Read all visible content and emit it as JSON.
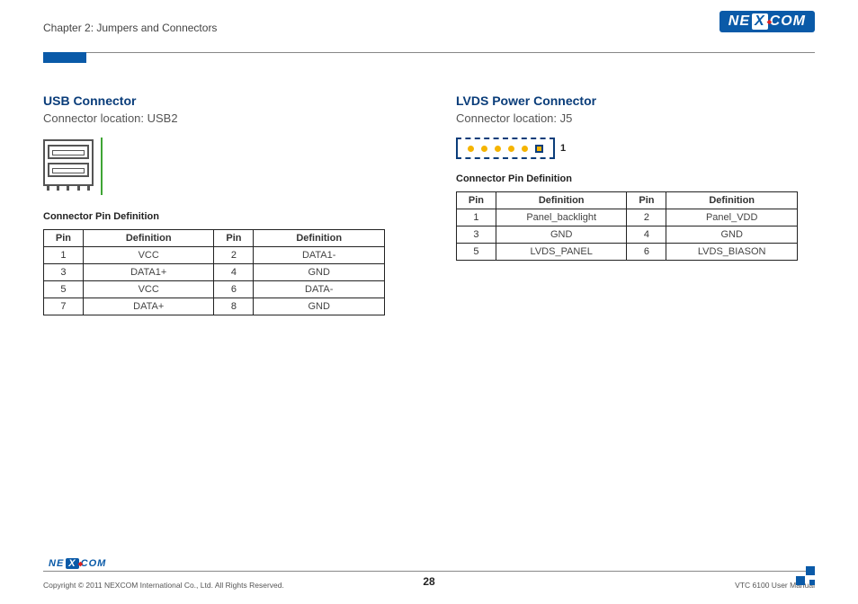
{
  "header": {
    "chapter": "Chapter 2: Jumpers and Connectors",
    "logo_text_left": "NE",
    "logo_text_mid": "X",
    "logo_text_right": "COM"
  },
  "left": {
    "title": "USB Connector",
    "subtitle": "Connector location: USB2",
    "table_title": "Connector Pin Definition",
    "headers": {
      "pin": "Pin",
      "def": "Definition"
    },
    "rows": [
      {
        "p1": "1",
        "d1": "VCC",
        "p2": "2",
        "d2": "DATA1-"
      },
      {
        "p1": "3",
        "d1": "DATA1+",
        "p2": "4",
        "d2": "GND"
      },
      {
        "p1": "5",
        "d1": "VCC",
        "p2": "6",
        "d2": "DATA-"
      },
      {
        "p1": "7",
        "d1": "DATA+",
        "p2": "8",
        "d2": "GND"
      }
    ]
  },
  "right": {
    "title": "LVDS Power Connector",
    "subtitle": "Connector location: J5",
    "pin1_label": "1",
    "table_title": "Connector Pin Definition",
    "headers": {
      "pin": "Pin",
      "def": "Definition"
    },
    "rows": [
      {
        "p1": "1",
        "d1": "Panel_backlight",
        "p2": "2",
        "d2": "Panel_VDD"
      },
      {
        "p1": "3",
        "d1": "GND",
        "p2": "4",
        "d2": "GND"
      },
      {
        "p1": "5",
        "d1": "LVDS_PANEL",
        "p2": "6",
        "d2": "LVDS_BIASON"
      }
    ]
  },
  "footer": {
    "copyright": "Copyright © 2011 NEXCOM International Co., Ltd. All Rights Reserved.",
    "page": "28",
    "manual": "VTC 6100 User Manual"
  }
}
